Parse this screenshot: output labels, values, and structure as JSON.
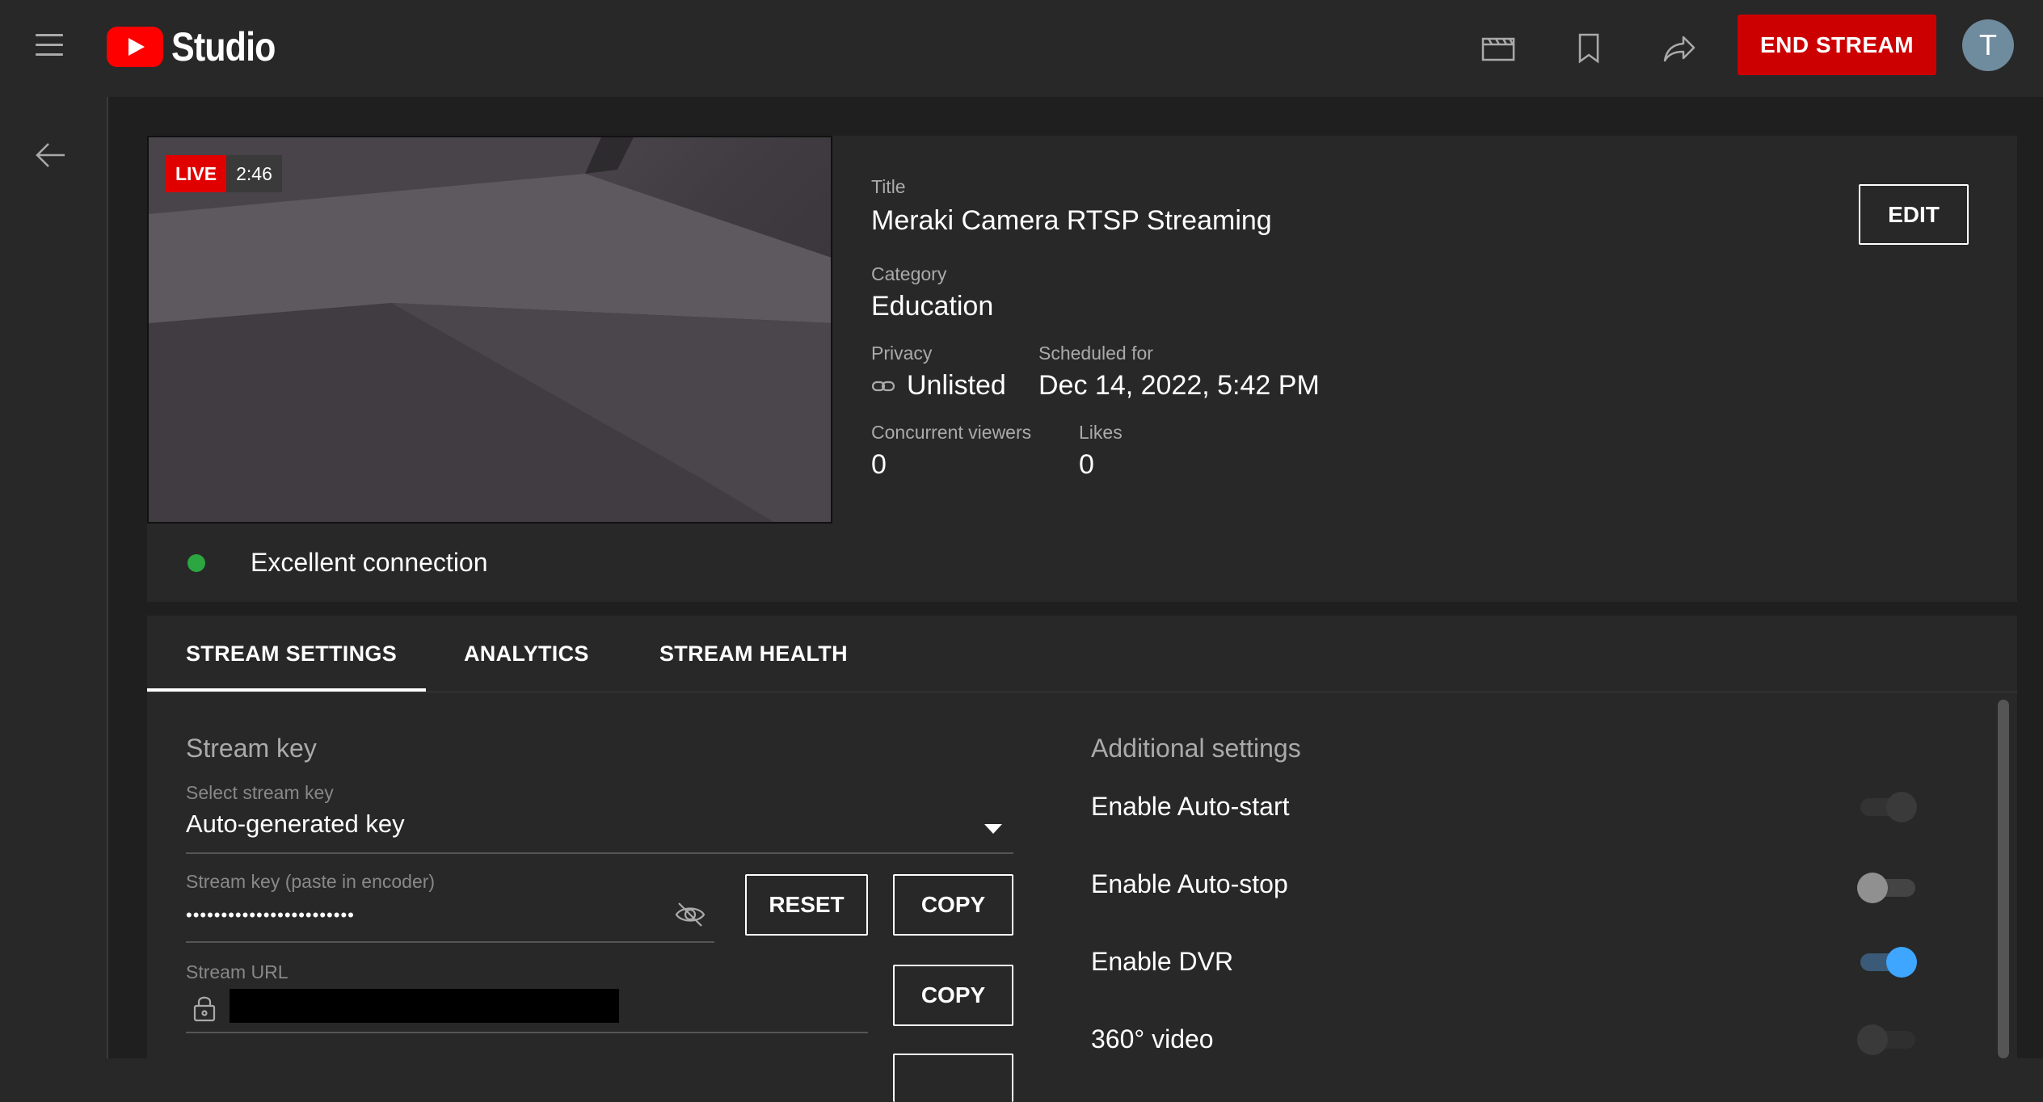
{
  "app": {
    "logo_text": "Studio"
  },
  "header": {
    "end_stream_label": "END STREAM",
    "avatar_letter": "T"
  },
  "video": {
    "live_label": "LIVE",
    "elapsed": "2:46"
  },
  "details": {
    "title_label": "Title",
    "title": "Meraki Camera RTSP Streaming",
    "category_label": "Category",
    "category": "Education",
    "privacy_label": "Privacy",
    "privacy": "Unlisted",
    "scheduled_label": "Scheduled for",
    "scheduled": "Dec 14, 2022, 5:42 PM",
    "viewers_label": "Concurrent viewers",
    "viewers": "0",
    "likes_label": "Likes",
    "likes": "0",
    "edit_label": "EDIT"
  },
  "connection": {
    "status": "Excellent connection",
    "color": "#2ba640"
  },
  "tabs": [
    {
      "label": "STREAM SETTINGS",
      "active": true
    },
    {
      "label": "ANALYTICS",
      "active": false
    },
    {
      "label": "STREAM HEALTH",
      "active": false
    }
  ],
  "stream_key": {
    "section_title": "Stream key",
    "select_label": "Select stream key",
    "select_value": "Auto-generated key",
    "key_label": "Stream key (paste in encoder)",
    "key_value": "••••••••••••••••••••••••",
    "reset_label": "RESET",
    "copy_label": "COPY",
    "url_label": "Stream URL",
    "url_copy_label": "COPY"
  },
  "additional": {
    "section_title": "Additional settings",
    "settings": [
      {
        "label": "Enable Auto-start",
        "on": false
      },
      {
        "label": "Enable Auto-stop",
        "on": false
      },
      {
        "label": "Enable DVR",
        "on": true
      },
      {
        "label": "360° video",
        "on": false
      }
    ]
  },
  "colors": {
    "accent_red": "#cc0000",
    "toggle_on": "#3ea6ff"
  }
}
